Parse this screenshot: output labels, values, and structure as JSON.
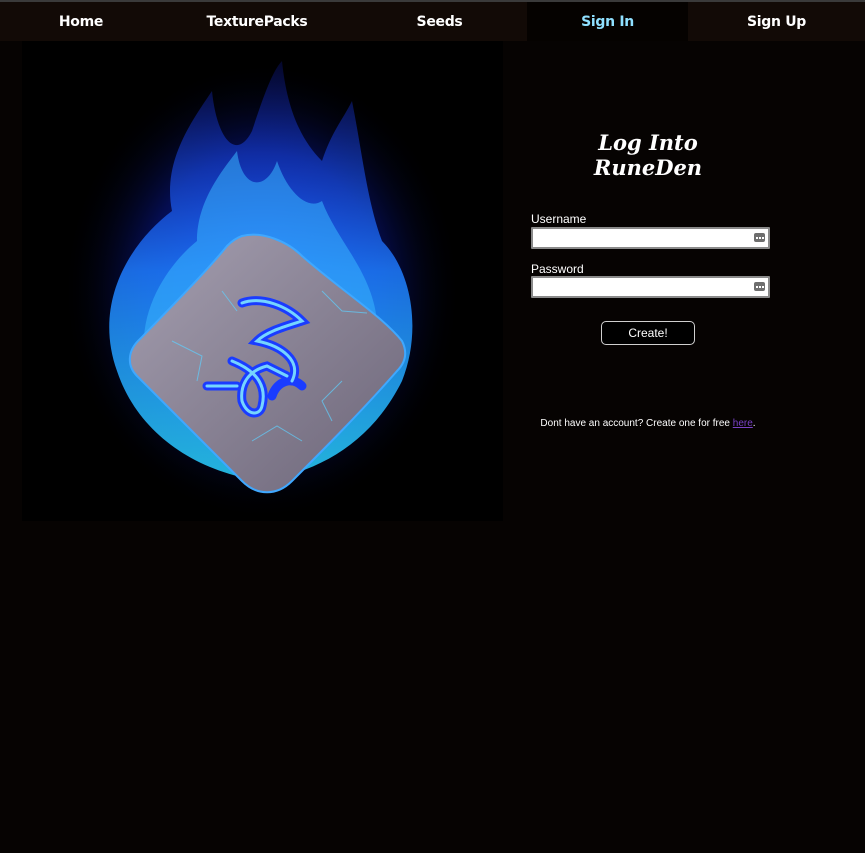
{
  "nav": {
    "items": [
      {
        "label": "Home"
      },
      {
        "label": "TexturePacks"
      },
      {
        "label": "Seeds"
      },
      {
        "label": "Sign In",
        "active": true
      },
      {
        "label": "Sign Up"
      }
    ]
  },
  "hero": {
    "image_alt": "blue-flaming-rune-stone"
  },
  "login": {
    "title": "Log Into RuneDen",
    "username_label": "Username",
    "username_value": "",
    "password_label": "Password",
    "password_value": "",
    "submit_label": "Create!",
    "signup_prefix": "Dont have an account? Create one for free ",
    "signup_link": "here",
    "signup_suffix": "."
  },
  "colors": {
    "page_bg": "#060302",
    "nav_bg": "#120a06",
    "active_nav_text": "#8fe0ff",
    "link": "#7a42c8"
  }
}
